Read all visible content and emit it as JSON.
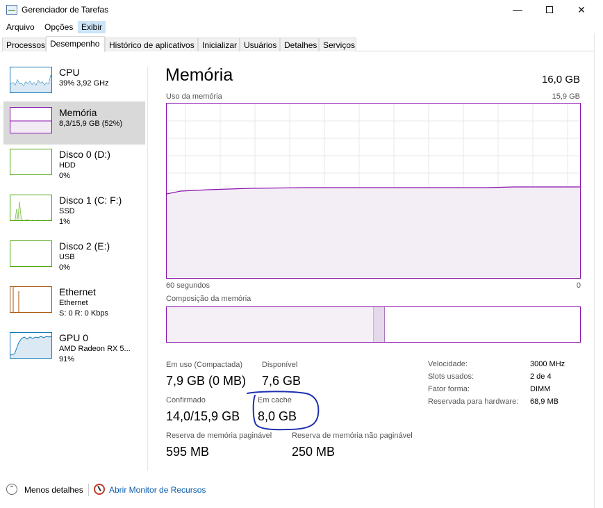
{
  "window": {
    "title": "Gerenciador de Tarefas",
    "minimize_glyph": "—",
    "close_glyph": "✕"
  },
  "menu": {
    "items": [
      "Arquivo",
      "Opções",
      "Exibir"
    ]
  },
  "tabs": [
    "Processos",
    "Desempenho",
    "Histórico de aplicativos",
    "Inicializar",
    "Usuários",
    "Detalhes",
    "Serviços"
  ],
  "sidebar": {
    "items": [
      {
        "name": "CPU",
        "line1": "39% 3,92 GHz",
        "line2": "",
        "color": "#1178b8"
      },
      {
        "name": "Memória",
        "line1": "8,3/15,9 GB (52%)",
        "line2": "",
        "color": "#8b12ae"
      },
      {
        "name": "Disco 0 (D:)",
        "line1": "HDD",
        "line2": "0%",
        "color": "#4da60c"
      },
      {
        "name": "Disco 1 (C: F:)",
        "line1": "SSD",
        "line2": "1%",
        "color": "#4da60c"
      },
      {
        "name": "Disco 2 (E:)",
        "line1": "USB",
        "line2": "0%",
        "color": "#4da60c"
      },
      {
        "name": "Ethernet",
        "line1": "Ethernet",
        "line2": "S: 0 R: 0 Kbps",
        "color": "#a74f01"
      },
      {
        "name": "GPU 0",
        "line1": "AMD Radeon RX 5...",
        "line2": "91%",
        "color": "#1178b8"
      }
    ]
  },
  "main": {
    "title": "Memória",
    "total": "16,0 GB",
    "usage_label": "Uso da memória",
    "usage_max": "15,9 GB",
    "time_label": "60 segundos",
    "time_end": "0",
    "composition_label": "Composição da memória",
    "stats": {
      "in_use_label": "Em uso (Compactada)",
      "in_use_value": "7,9 GB (0 MB)",
      "available_label": "Disponível",
      "available_value": "7,6 GB",
      "committed_label": "Confirmado",
      "committed_value": "14,0/15,9 GB",
      "cached_label": "Em cache",
      "cached_value": "8,0 GB",
      "paged_label": "Reserva de memória paginável",
      "paged_value": "595 MB",
      "nonpaged_label": "Reserva de memória não paginável",
      "nonpaged_value": "250 MB"
    },
    "specs": [
      {
        "label": "Velocidade:",
        "value": "3000 MHz"
      },
      {
        "label": "Slots usados:",
        "value": "2 de 4"
      },
      {
        "label": "Fator forma:",
        "value": "DIMM"
      },
      {
        "label": "Reservada para hardware:",
        "value": "68,9 MB"
      }
    ]
  },
  "footer": {
    "less_details": "Menos detalhes",
    "resource_monitor": "Abrir Monitor de Recursos"
  },
  "colors": {
    "memory_accent": "#8b12ae",
    "annotation": "#1f2fb0",
    "link": "#0b5cad"
  }
}
